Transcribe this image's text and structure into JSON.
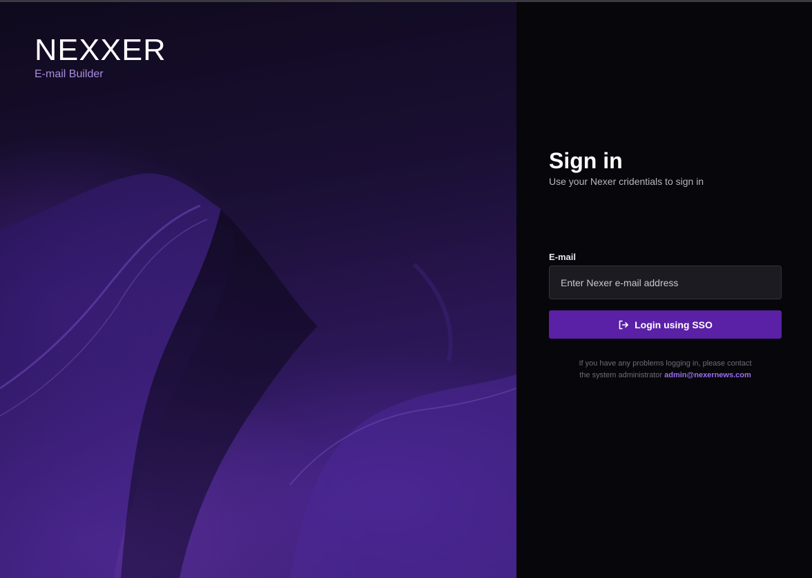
{
  "brand": {
    "logo_text": "NEXXER",
    "product_name": "E-mail Builder"
  },
  "signin": {
    "title": "Sign in",
    "subtitle": "Use your Nexer cridentials to sign in",
    "email_label": "E-mail",
    "email_placeholder": "Enter Nexer e-mail address",
    "email_value": "",
    "sso_button_label": "Login using SSO",
    "sso_icon": "login-arrow-icon",
    "help_text_line1": "If you have any problems logging in, please contact",
    "help_text_line2": "the system administrator",
    "admin_email": "admin@nexernews.com"
  },
  "colors": {
    "accent": "#5a21a6",
    "link": "#9b6ff0",
    "brand_sub": "#a98ce0",
    "panel_bg": "#07060b"
  }
}
